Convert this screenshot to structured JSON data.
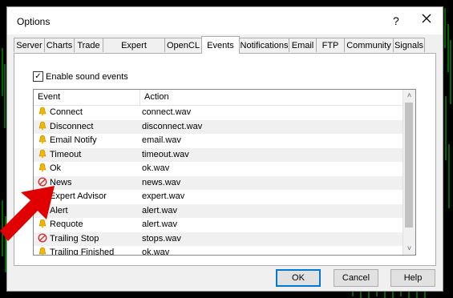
{
  "window": {
    "title": "Options",
    "help_glyph": "?",
    "close_glyph": "X"
  },
  "tabs": [
    {
      "label": "Server"
    },
    {
      "label": "Charts"
    },
    {
      "label": "Trade"
    },
    {
      "label": "Expert Advisors"
    },
    {
      "label": "OpenCL"
    },
    {
      "label": "Events",
      "active": true
    },
    {
      "label": "Notifications"
    },
    {
      "label": "Email"
    },
    {
      "label": "FTP"
    },
    {
      "label": "Community"
    },
    {
      "label": "Signals"
    }
  ],
  "enable_sound": {
    "label": "Enable sound events",
    "checked": true,
    "check_glyph": "✓"
  },
  "events_table": {
    "headers": {
      "event": "Event",
      "action": "Action"
    },
    "rows": [
      {
        "event": "Connect",
        "action": "connect.wav",
        "icon": "bell-icon"
      },
      {
        "event": "Disconnect",
        "action": "disconnect.wav",
        "icon": "bell-icon"
      },
      {
        "event": "Email Notify",
        "action": "email.wav",
        "icon": "bell-icon"
      },
      {
        "event": "Timeout",
        "action": "timeout.wav",
        "icon": "bell-icon"
      },
      {
        "event": "Ok",
        "action": "ok.wav",
        "icon": "bell-icon"
      },
      {
        "event": "News",
        "action": "news.wav",
        "icon": "disabled-icon"
      },
      {
        "event": "Expert Advisor",
        "action": "expert.wav",
        "icon": "bell-icon"
      },
      {
        "event": "Alert",
        "action": "alert.wav",
        "icon": "bell-icon"
      },
      {
        "event": "Requote",
        "action": "alert.wav",
        "icon": "bell-icon"
      },
      {
        "event": "Trailing Stop",
        "action": "stops.wav",
        "icon": "disabled-icon"
      },
      {
        "event": "Trailing Finished",
        "action": "ok.wav",
        "icon": "bell-icon"
      }
    ]
  },
  "buttons": {
    "ok": "OK",
    "cancel": "Cancel",
    "help": "Help"
  },
  "colors": {
    "bell": "#f2b600",
    "disabled": "#d32f2f",
    "arrow": "#e00000",
    "chart_line": "#00c800"
  }
}
